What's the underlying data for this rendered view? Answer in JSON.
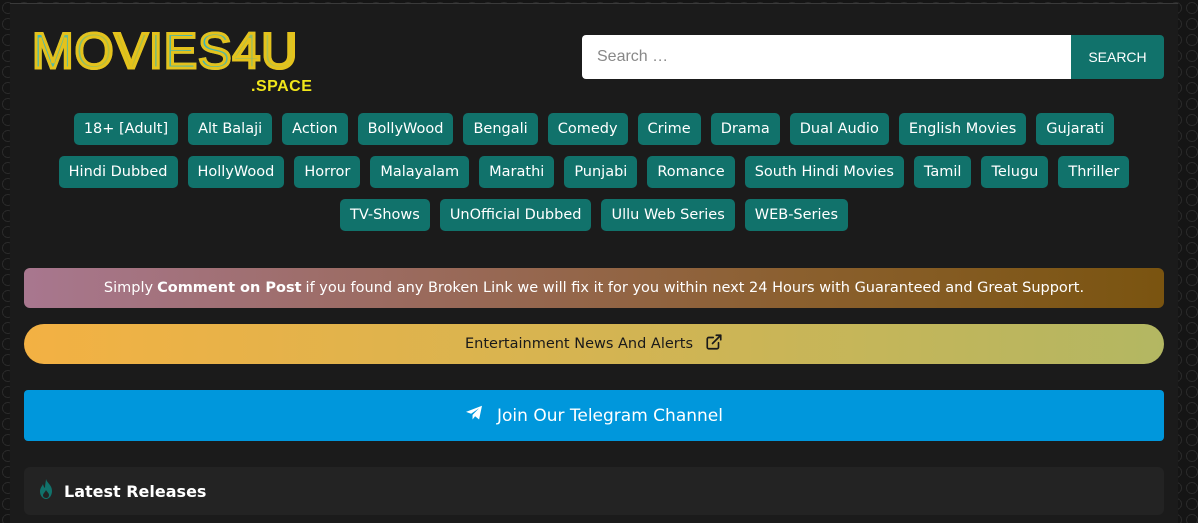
{
  "logo": {
    "main": "MOVIES4U",
    "sub": ".SPACE"
  },
  "search": {
    "placeholder": "Search …",
    "button_label": "SEARCH"
  },
  "categories": [
    "18+ [Adult]",
    "Alt Balaji",
    "Action",
    "BollyWood",
    "Bengali",
    "Comedy",
    "Crime",
    "Drama",
    "Dual Audio",
    "English Movies",
    "Gujarati",
    "Hindi Dubbed",
    "HollyWood",
    "Horror",
    "Malayalam",
    "Marathi",
    "Punjabi",
    "Romance",
    "South Hindi Movies",
    "Tamil",
    "Telugu",
    "Thriller",
    "TV-Shows",
    "UnOfficial Dubbed",
    "Ullu Web Series",
    "WEB-Series"
  ],
  "notice": {
    "prefix": "Simply",
    "bold": "Comment on Post",
    "suffix": "if you found any Broken Link we will fix it for you within next 24 Hours with Guaranteed and Great Support."
  },
  "news": {
    "label": "Entertainment News And Alerts",
    "icon": "external-link-icon"
  },
  "telegram": {
    "label": "Join Our Telegram Channel",
    "icon": "telegram-icon"
  },
  "latest": {
    "title": "Latest Releases",
    "icon": "flame-icon"
  },
  "colors": {
    "accent": "#11726b",
    "telegram": "#0097dc",
    "background": "#1b1b1b"
  }
}
